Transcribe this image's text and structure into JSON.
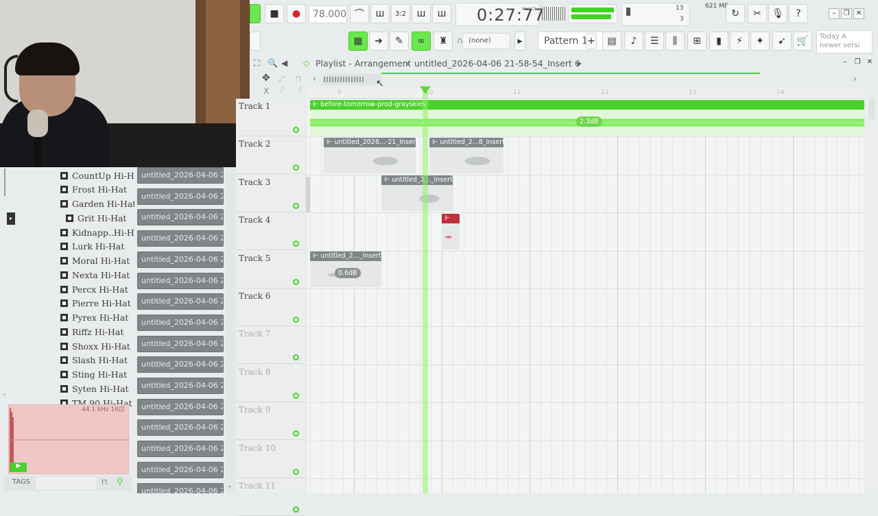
{
  "toolbar": {
    "tempo": "78.000",
    "time": "0:27:77",
    "time_unit": "M:S:CS",
    "cpu_value": "13",
    "voices": "3",
    "memory": "621 MB",
    "snap": "(none)",
    "pattern": "Pattern 1",
    "news_line1": "Today  A",
    "news_line2": "newer versi"
  },
  "playlist": {
    "title": "Playlist - Arrangement",
    "separator": "›",
    "breadcrumb": "untitled_2026-04-06 21-58-54_Insert 6",
    "ruler": [
      "9",
      "10",
      "11",
      "12",
      "13",
      "14"
    ]
  },
  "browser": {
    "items": [
      "CountUp Hi-Hat",
      "Frost Hi-Hat",
      "Garden Hi-Hat",
      "Grit Hi-Hat",
      "Kidnapp..Hi-Hat",
      "Lurk Hi-Hat",
      "Moral Hi-Hat",
      "Nexta Hi-Hat",
      "Percx Hi-Hat",
      "Pierre Hi-Hat",
      "Pyrex Hi-Hat",
      "Riffz Hi-Hat",
      "Shoxx Hi-Hat",
      "Slash Hi-Hat",
      "Sting Hi-Hat",
      "Syten Hi-Hat",
      "TM 90 Hi-Hat"
    ],
    "preview_info": "44.1 kHz 16",
    "tags_label": "TAGS"
  },
  "clip_list": {
    "label": "untitled_2026-04-06 21-...",
    "count": 16
  },
  "tracks": [
    "Track 1",
    "Track 2",
    "Track 3",
    "Track 4",
    "Track 5",
    "Track 6",
    "Track 7",
    "Track 8",
    "Track 9",
    "Track 10",
    "Track 11"
  ],
  "clips": {
    "c1": {
      "name": "before-tomorrow-prod-grayskies",
      "gain": "2.3dB"
    },
    "c2": {
      "name": "untitled_2026...-21_Insert 6"
    },
    "c3": {
      "name": "untitled_2...8_Insert 6"
    },
    "c4": {
      "name": "untitled_2..._Insert 6"
    },
    "c5": {
      "name": ""
    },
    "c6": {
      "name": "untitled_2..._Insert 6",
      "gain": "0.6dB"
    }
  },
  "colors": {
    "accent_green": "#6be84d",
    "clip_gray": "#7f8688",
    "clip_red": "#c0303a",
    "record_red": "#d8242b"
  }
}
